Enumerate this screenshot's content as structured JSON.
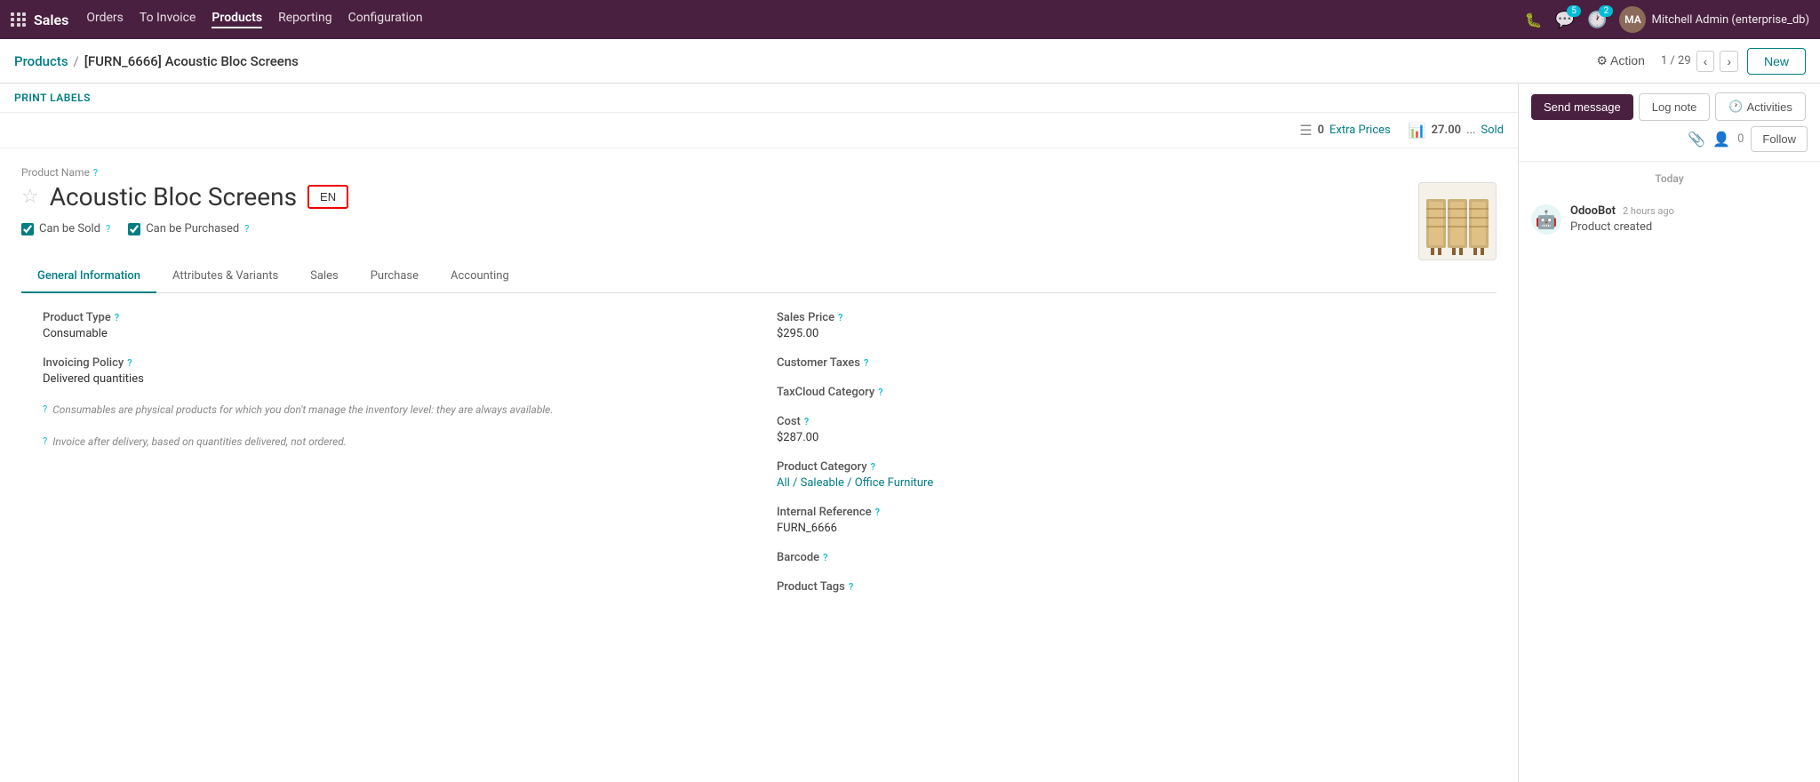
{
  "app": {
    "name": "Sales",
    "nav_items": [
      "Orders",
      "To Invoice",
      "Products",
      "Reporting",
      "Configuration"
    ]
  },
  "topbar": {
    "nav_icons": {
      "grid_icon": "⊞",
      "chat_badge": "5",
      "clock_badge": "2"
    },
    "user": {
      "display": "Mitchell Admin (enterprise_db)",
      "initials": "MA"
    }
  },
  "breadcrumb": {
    "parent": "Products",
    "separator": "/",
    "current": "[FURN_6666] Acoustic Bloc Screens"
  },
  "toolbar": {
    "action_label": "⚙ Action",
    "counter": "1 / 29",
    "new_label": "New",
    "follow_label": "Follow"
  },
  "print_labels": {
    "label": "PRINT LABELS"
  },
  "stats": {
    "extra_prices_count": "0",
    "extra_prices_label": "Extra Prices",
    "sold_count": "27.00",
    "sold_label": "Sold",
    "dots": "..."
  },
  "product": {
    "name_label": "Product Name",
    "help": "?",
    "star": "☆",
    "name": "Acoustic Bloc Screens",
    "lang": "EN",
    "can_be_sold": true,
    "can_be_sold_label": "Can be Sold",
    "can_be_purchased": true,
    "can_be_purchased_label": "Can be Purchased"
  },
  "tabs": [
    {
      "id": "general",
      "label": "General Information",
      "active": true
    },
    {
      "id": "attributes",
      "label": "Attributes & Variants",
      "active": false
    },
    {
      "id": "sales",
      "label": "Sales",
      "active": false
    },
    {
      "id": "purchase",
      "label": "Purchase",
      "active": false
    },
    {
      "id": "accounting",
      "label": "Accounting",
      "active": false
    }
  ],
  "general_tab": {
    "left": {
      "product_type_label": "Product Type",
      "product_type_help": "?",
      "product_type_value": "Consumable",
      "invoicing_policy_label": "Invoicing Policy",
      "invoicing_policy_help": "?",
      "invoicing_policy_value": "Delivered quantities",
      "note1_help": "?",
      "note1_text": "Consumables are physical products for which you don't manage the inventory level: they are always available.",
      "note2_help": "?",
      "note2_text": "Invoice after delivery, based on quantities delivered, not ordered."
    },
    "right": {
      "sales_price_label": "Sales Price",
      "sales_price_help": "?",
      "sales_price_value": "$295.00",
      "customer_taxes_label": "Customer Taxes",
      "customer_taxes_help": "?",
      "customer_taxes_value": "",
      "taxcloud_label": "TaxCloud Category",
      "taxcloud_help": "?",
      "taxcloud_value": "",
      "cost_label": "Cost",
      "cost_help": "?",
      "cost_value": "$287.00",
      "product_category_label": "Product Category",
      "product_category_help": "?",
      "product_category_value": "All / Saleable / Office Furniture",
      "internal_ref_label": "Internal Reference",
      "internal_ref_help": "?",
      "internal_ref_value": "FURN_6666",
      "barcode_label": "Barcode",
      "barcode_help": "?",
      "barcode_value": "",
      "product_tags_label": "Product Tags",
      "product_tags_help": "?",
      "product_tags_value": ""
    }
  },
  "chatter": {
    "send_message": "Send message",
    "log_note": "Log note",
    "activities": "Activities",
    "follow": "Follow",
    "today_label": "Today",
    "message": {
      "author": "OdooBot",
      "time": "2 hours ago",
      "body": "Product created"
    }
  }
}
